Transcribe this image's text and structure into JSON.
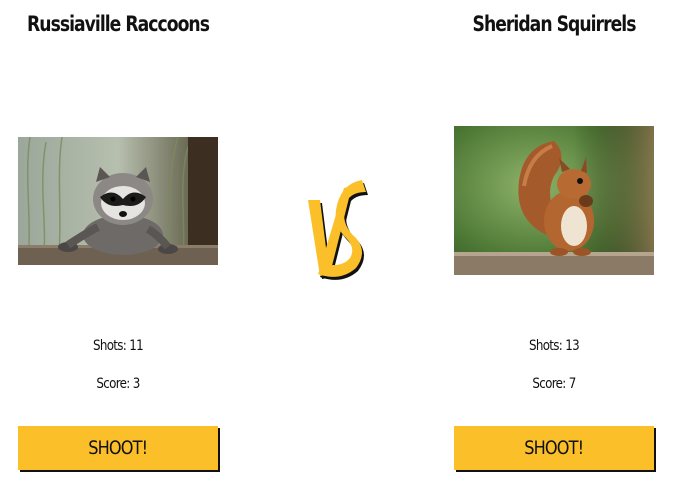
{
  "home": {
    "name": "Russiaville Raccoons",
    "photo_icon": "raccoon-photo",
    "shots_text": "Shots: 11",
    "score_text": "Score: 3",
    "shoot_label": "SHOOT!"
  },
  "away": {
    "name": "Sheridan Squirrels",
    "photo_icon": "squirrel-photo",
    "shots_text": "Shots: 13",
    "score_text": "Score: 7",
    "shoot_label": "SHOOT!"
  },
  "vs_logo": {
    "icon": "vs-logo",
    "color": "#fbbf2a"
  },
  "colors": {
    "button": "#fbbf2a",
    "text": "#111111"
  }
}
